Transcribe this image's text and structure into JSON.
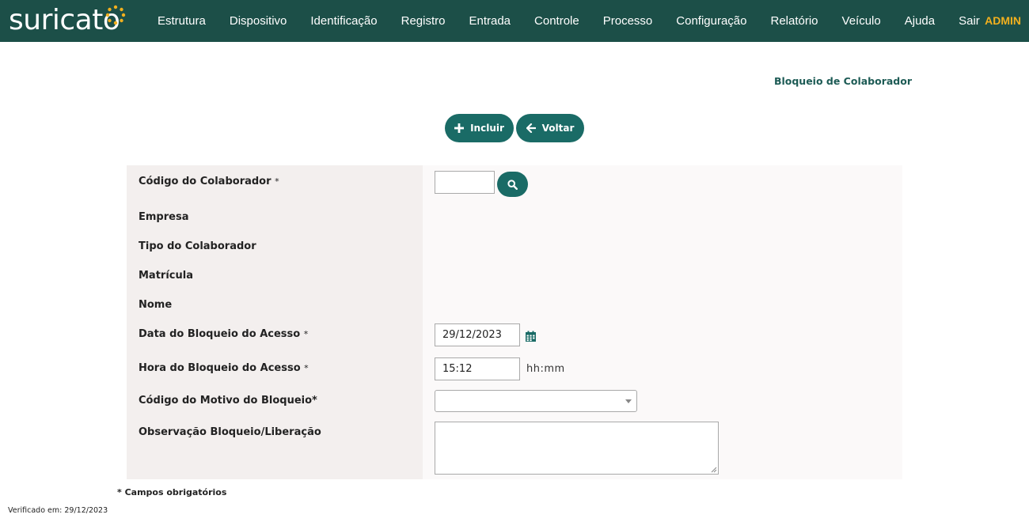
{
  "app": {
    "logo_text": "suricato",
    "user": "ADMIN"
  },
  "nav": {
    "items": [
      {
        "label": "Estrutura"
      },
      {
        "label": "Dispositivo"
      },
      {
        "label": "Identificação"
      },
      {
        "label": "Registro"
      },
      {
        "label": "Entrada"
      },
      {
        "label": "Controle"
      },
      {
        "label": "Processo"
      },
      {
        "label": "Configuração"
      },
      {
        "label": "Relatório"
      },
      {
        "label": "Veículo"
      },
      {
        "label": "Ajuda"
      },
      {
        "label": "Sair"
      }
    ]
  },
  "page": {
    "title": "Bloqueio de Colaborador"
  },
  "toolbar": {
    "incluir_label": "Incluir",
    "voltar_label": "Voltar"
  },
  "form": {
    "codigo_colaborador": {
      "label": "Código do Colaborador",
      "required_mark": "*",
      "value": ""
    },
    "empresa": {
      "label": "Empresa"
    },
    "tipo_colaborador": {
      "label": "Tipo do Colaborador"
    },
    "matricula": {
      "label": "Matrícula"
    },
    "nome": {
      "label": "Nome"
    },
    "data_bloqueio": {
      "label": "Data do Bloqueio do Acesso",
      "required_mark": "*",
      "value": "29/12/2023"
    },
    "hora_bloqueio": {
      "label": "Hora do Bloqueio do Acesso",
      "required_mark": "*",
      "value": "15:12",
      "hint": "hh:mm"
    },
    "motivo_bloqueio": {
      "label": "Código do Motivo do Bloqueio*",
      "value": ""
    },
    "observacao": {
      "label": "Observação Bloqueio/Liberação",
      "value": ""
    }
  },
  "footer": {
    "required_note": "* Campos obrigatórios",
    "verified": "Verificado em: 29/12/2023"
  },
  "colors": {
    "header_bg": "#1c4f48",
    "accent": "#1a6b66",
    "admin": "#f2b01e",
    "logo_dots": "#f2b01e"
  },
  "icons": [
    "plus-icon",
    "arrow-left-icon",
    "search-icon",
    "calendar-icon",
    "chevron-down-icon"
  ]
}
